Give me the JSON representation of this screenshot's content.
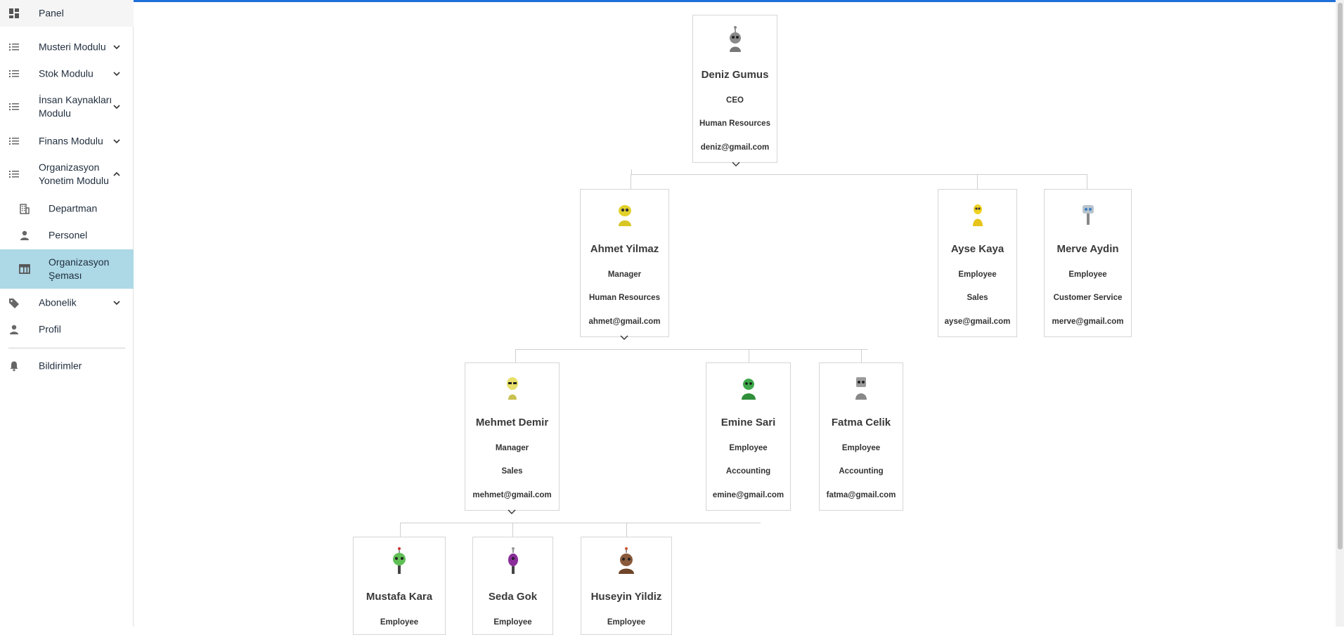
{
  "sidebar": {
    "items": [
      {
        "label": "Panel",
        "icon": "dashboard-icon"
      },
      {
        "label": "Musteri Modulu",
        "icon": "list-icon"
      },
      {
        "label": "Stok Modulu",
        "icon": "list-icon"
      },
      {
        "label": "İnsan Kaynakları Modulu",
        "icon": "list-icon"
      },
      {
        "label": "Finans Modulu",
        "icon": "list-icon"
      },
      {
        "label": "Organizasyon Yonetim Modulu",
        "icon": "list-icon"
      },
      {
        "label": "Departman",
        "icon": "building-icon"
      },
      {
        "label": "Personel",
        "icon": "person-icon"
      },
      {
        "label": "Organizasyon Şeması",
        "icon": "table-icon"
      },
      {
        "label": "Abonelik",
        "icon": "tag-icon"
      },
      {
        "label": "Profil",
        "icon": "person-icon"
      },
      {
        "label": "Bildirimler",
        "icon": "bell-icon"
      }
    ],
    "active_color": "#add8e6"
  },
  "org": {
    "nodes": [
      {
        "name": "Deniz Gumus",
        "role": "CEO",
        "department": "Human Resources",
        "email": "deniz@gmail.com"
      },
      {
        "name": "Ahmet Yilmaz",
        "role": "Manager",
        "department": "Human Resources",
        "email": "ahmet@gmail.com"
      },
      {
        "name": "Ayse Kaya",
        "role": "Employee",
        "department": "Sales",
        "email": "ayse@gmail.com"
      },
      {
        "name": "Merve Aydin",
        "role": "Employee",
        "department": "Customer Service",
        "email": "merve@gmail.com"
      },
      {
        "name": "Mehmet Demir",
        "role": "Manager",
        "department": "Sales",
        "email": "mehmet@gmail.com"
      },
      {
        "name": "Emine Sari",
        "role": "Employee",
        "department": "Accounting",
        "email": "emine@gmail.com"
      },
      {
        "name": "Fatma Celik",
        "role": "Employee",
        "department": "Accounting",
        "email": "fatma@gmail.com"
      },
      {
        "name": "Mustafa Kara",
        "role": "Employee"
      },
      {
        "name": "Seda Gok",
        "role": "Employee"
      },
      {
        "name": "Huseyin Yildiz",
        "role": "Employee"
      }
    ]
  },
  "colors": {
    "accent": "#1e6fd9"
  }
}
